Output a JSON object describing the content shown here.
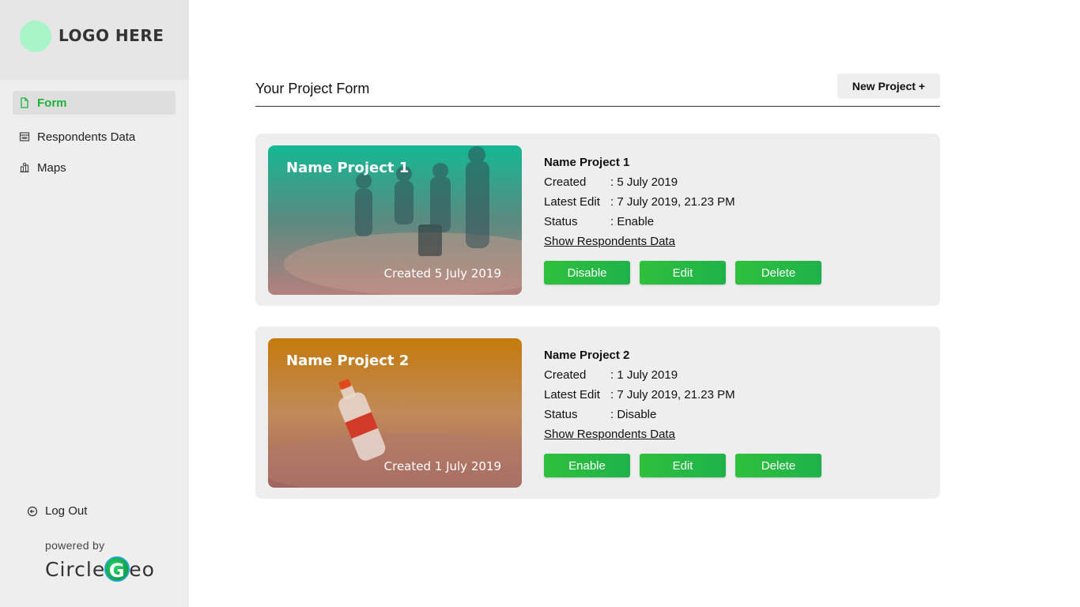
{
  "brand": {
    "logo_text": "LOGO HERE",
    "powered_by": "powered by",
    "name_left": "Circle",
    "name_g": "G",
    "name_right": "eo"
  },
  "sidebar": {
    "items": [
      {
        "label": "Form",
        "icon": "document-icon",
        "active": true
      },
      {
        "label": "Respondents Data",
        "icon": "table-icon",
        "active": false
      },
      {
        "label": "Maps",
        "icon": "map-icon",
        "active": false
      }
    ],
    "logout": {
      "label": "Log Out",
      "icon": "logout-icon"
    }
  },
  "main": {
    "title": "Your Project Form",
    "new_project_label": "New Project +"
  },
  "projects": [
    {
      "thumb_title": "Name Project 1",
      "thumb_date": "Created 5 July 2019",
      "name": "Name Project 1",
      "created_key": "Created",
      "created_val": ": 5 July 2019",
      "edit_key": "Latest Edit",
      "edit_val": ": 7 July 2019, 21.23 PM",
      "status_key": "Status",
      "status_val": ": Enable",
      "link": "Show Respondents Data",
      "toggle_label": "Disable",
      "edit_label": "Edit",
      "delete_label": "Delete"
    },
    {
      "thumb_title": "Name Project 2",
      "thumb_date": "Created 1 July 2019",
      "name": "Name Project 2",
      "created_key": "Created",
      "created_val": ": 1 July 2019",
      "edit_key": "Latest Edit",
      "edit_val": ": 7 July 2019, 21.23 PM",
      "status_key": "Status",
      "status_val": ": Disable",
      "link": "Show Respondents Data",
      "toggle_label": "Enable",
      "edit_label": "Edit",
      "delete_label": "Delete"
    }
  ],
  "colors": {
    "accent": "#1db33b",
    "button": "#2fc03d",
    "sidebar": "#eeeeee"
  }
}
